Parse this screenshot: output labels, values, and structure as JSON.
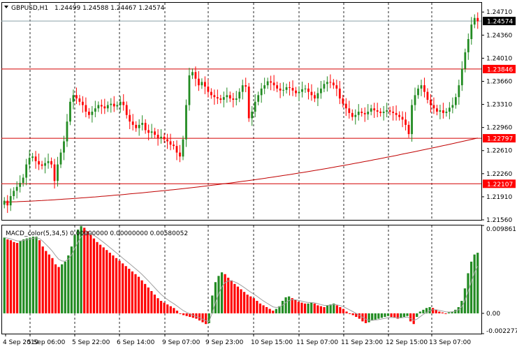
{
  "header": {
    "symbol": "GBPUSD,H1",
    "ohlc": "1.24499 1.24588 1.24467 1.24574"
  },
  "indicator": {
    "label": "MACD_color(5,34,5) 0.00000000 0.00000000 0.00580052"
  },
  "colors": {
    "bull": "#228b22",
    "bear": "#ff0000",
    "level_line": "#d40000",
    "ma_line": "#c00000",
    "grid": "#000000",
    "price_tag": "#000000",
    "level_tag": "#ff0000"
  },
  "chart_data": [
    {
      "type": "candlestick",
      "y_ticks": [
        "1.24710",
        "1.24360",
        "1.24010",
        "1.23660",
        "1.23310",
        "1.22960",
        "1.22610",
        "1.22260",
        "1.21910",
        "1.21560"
      ],
      "ylim": [
        1.2156,
        1.2485
      ],
      "current_price": "1.24574",
      "levels": [
        {
          "value": 1.23846,
          "label": "1.23846"
        },
        {
          "value": 1.22797,
          "label": "1.22797"
        },
        {
          "value": 1.22107,
          "label": "1.22107"
        }
      ],
      "x_ticks": [
        "4 Sep 2019",
        "5 Sep 06:00",
        "5 Sep 22:00",
        "6 Sep 14:00",
        "9 Sep 07:00",
        "9 Sep 23:00",
        "10 Sep 15:00",
        "11 Sep 07:00",
        "11 Sep 23:00",
        "12 Sep 15:00",
        "13 Sep 07:00"
      ],
      "close_series": [
        1.2185,
        1.2178,
        1.2192,
        1.22,
        1.2206,
        1.2212,
        1.222,
        1.224,
        1.225,
        1.2252,
        1.2245,
        1.224,
        1.2238,
        1.2242,
        1.2245,
        1.224,
        1.2215,
        1.224,
        1.2258,
        1.2275,
        1.2305,
        1.2335,
        1.2345,
        1.234,
        1.2335,
        1.233,
        1.232,
        1.2315,
        1.232,
        1.2325,
        1.233,
        1.2328,
        1.2325,
        1.233,
        1.2332,
        1.2328,
        1.233,
        1.2335,
        1.233,
        1.2315,
        1.2305,
        1.23,
        1.2295,
        1.23,
        1.2303,
        1.2292,
        1.2288,
        1.229,
        1.2285,
        1.228,
        1.2282,
        1.2278,
        1.2275,
        1.227,
        1.2268,
        1.2258,
        1.2252,
        1.2278,
        1.233,
        1.2375,
        1.238,
        1.237,
        1.236,
        1.2365,
        1.2358,
        1.235,
        1.2345,
        1.2342,
        1.234,
        1.2338,
        1.2342,
        1.2345,
        1.234,
        1.2338,
        1.234,
        1.235,
        1.236,
        1.2358,
        1.231,
        1.232,
        1.2335,
        1.2345,
        1.2355,
        1.236,
        1.2366,
        1.2364,
        1.236,
        1.2355,
        1.2352,
        1.2353,
        1.2357,
        1.2356,
        1.2352,
        1.2348,
        1.235,
        1.2354,
        1.2355,
        1.235,
        1.2345,
        1.234,
        1.2348,
        1.2355,
        1.2362,
        1.2365,
        1.2364,
        1.236,
        1.2355,
        1.234,
        1.2332,
        1.2325,
        1.2318,
        1.2312,
        1.2315,
        1.232,
        1.2318,
        1.2316,
        1.232,
        1.2325,
        1.2322,
        1.232,
        1.2318,
        1.232,
        1.2322,
        1.232,
        1.2318,
        1.2315,
        1.2312,
        1.2308,
        1.23,
        1.2286,
        1.233,
        1.2345,
        1.2355,
        1.236,
        1.235,
        1.2338,
        1.233,
        1.2325,
        1.232,
        1.2322,
        1.2318,
        1.232,
        1.2326,
        1.233,
        1.2342,
        1.236,
        1.2385,
        1.241,
        1.243,
        1.2452,
        1.2462,
        1.2457
      ]
    },
    {
      "type": "bar",
      "name": "MACD_color(5,34,5)",
      "y_ticks": [
        "0.0098611",
        "0.00",
        "-0.002277"
      ],
      "ylim": [
        -0.002277,
        0.0098611
      ],
      "values": [
        0.0085,
        0.0083,
        0.0082,
        0.008,
        0.0079,
        0.0081,
        0.0083,
        0.0084,
        0.0085,
        0.0086,
        0.0086,
        0.0082,
        0.0075,
        0.007,
        0.0066,
        0.0062,
        0.0055,
        0.0052,
        0.0055,
        0.0058,
        0.0065,
        0.0075,
        0.0088,
        0.0094,
        0.0098,
        0.0096,
        0.0092,
        0.0088,
        0.0084,
        0.008,
        0.0077,
        0.0074,
        0.0071,
        0.0068,
        0.0065,
        0.0062,
        0.0059,
        0.0056,
        0.0053,
        0.005,
        0.0047,
        0.0044,
        0.0041,
        0.0037,
        0.0033,
        0.0029,
        0.0025,
        0.0021,
        0.0017,
        0.0014,
        0.0012,
        0.001,
        0.0008,
        0.0006,
        0.0003,
        0.0,
        -0.0002,
        -0.0003,
        -0.0004,
        -0.0005,
        -0.0006,
        -0.0008,
        -0.001,
        -0.0012,
        -0.0011,
        0.002,
        0.0035,
        0.0042,
        0.0046,
        0.0044,
        0.004,
        0.0037,
        0.0033,
        0.003,
        0.0027,
        0.0024,
        0.0021,
        0.0019,
        0.0017,
        0.0014,
        0.0011,
        0.0009,
        0.0007,
        0.0005,
        0.0003,
        0.0005,
        0.0008,
        0.0014,
        0.0018,
        0.0019,
        0.0017,
        0.0015,
        0.0013,
        0.0012,
        0.0011,
        0.0011,
        0.0012,
        0.0011,
        0.0009,
        0.0008,
        0.0007,
        0.0009,
        0.001,
        0.0011,
        0.0009,
        0.0007,
        0.0005,
        0.0002,
        0.0,
        -0.0002,
        -0.0004,
        -0.0006,
        -0.0009,
        -0.0011,
        -0.001,
        -0.0008,
        -0.0007,
        -0.0006,
        -0.0005,
        -0.0004,
        -0.0003,
        -0.0004,
        -0.0005,
        -0.0006,
        -0.0005,
        -0.0004,
        -0.0003,
        -0.0009,
        -0.0012,
        -0.0004,
        0.0002,
        0.0004,
        0.0006,
        0.0007,
        0.0006,
        0.0004,
        0.0002,
        0.0001,
        0.0,
        0.0001,
        0.0002,
        0.0004,
        0.0007,
        0.0014,
        0.0028,
        0.0045,
        0.0058,
        0.0066,
        0.0068
      ]
    }
  ]
}
